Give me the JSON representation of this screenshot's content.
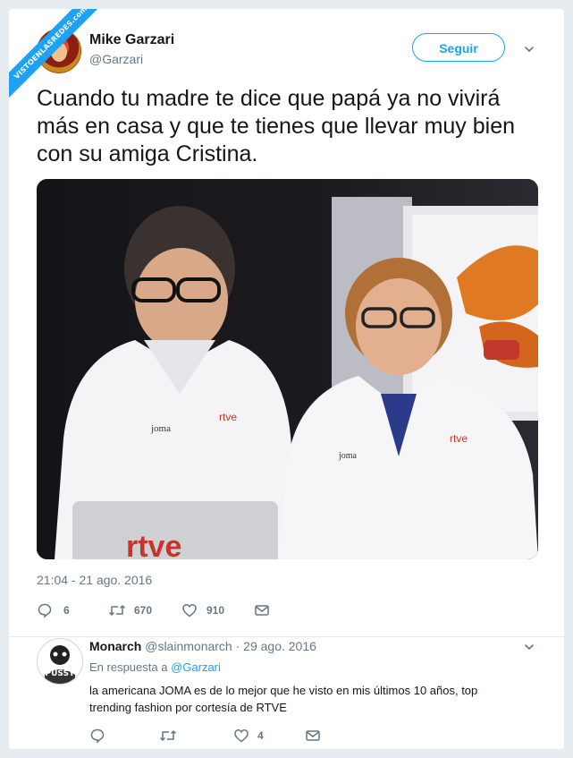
{
  "watermark": {
    "text": "VISTOENLASREDES",
    "suffix": ".com"
  },
  "tweet": {
    "author_name": "Mike Garzari",
    "author_handle": "@Garzari",
    "follow_label": "Seguir",
    "text": "Cuando tu madre te dice que papá ya no vivirá más en casa y que te tienes que llevar muy bien con su amiga Cristina.",
    "timestamp": "21:04 - 21 ago. 2016",
    "photo": {
      "brand_label": "joma",
      "logo_label": "rtve",
      "laptop_label": "rtve"
    },
    "actions": {
      "reply_count": "6",
      "retweet_count": "670",
      "like_count": "910"
    }
  },
  "reply": {
    "author_name": "Monarch",
    "author_handle": "@slainmonarch",
    "separator": "·",
    "date": "29 ago. 2016",
    "in_reply_prefix": "En respuesta a",
    "in_reply_handle": "@Garzari",
    "text": "la americana JOMA es de lo mejor que he visto en mis últimos 10 años, top trending fashion por cortesía de RTVE",
    "avatar_text": "PUSSY",
    "like_count": "4"
  },
  "colors": {
    "accent": "#1da1f2",
    "secondary_text": "#657786",
    "background": "#e6ecf0"
  },
  "icons": [
    "reply-icon",
    "retweet-icon",
    "heart-icon",
    "mail-icon",
    "chevron-down-icon"
  ]
}
